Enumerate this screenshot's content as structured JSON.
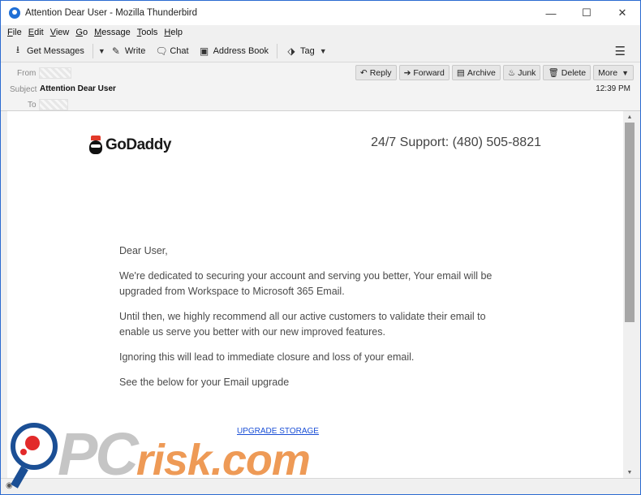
{
  "window": {
    "title": "Attention Dear User - Mozilla Thunderbird",
    "controls": {
      "minimize": "—",
      "maximize": "☐",
      "close": "✕"
    }
  },
  "menubar": [
    "File",
    "Edit",
    "View",
    "Go",
    "Message",
    "Tools",
    "Help"
  ],
  "toolbar": {
    "get_messages": "Get Messages",
    "write": "Write",
    "chat": "Chat",
    "address_book": "Address Book",
    "tag": "Tag"
  },
  "header": {
    "from_label": "From",
    "subject_label": "Subject",
    "subject_value": "Attention Dear User",
    "to_label": "To",
    "time": "12:39 PM",
    "actions": {
      "reply": "Reply",
      "forward": "Forward",
      "archive": "Archive",
      "junk": "Junk",
      "delete": "Delete",
      "more": "More"
    }
  },
  "email": {
    "logo": "GoDaddy",
    "support": "24/7 Support: (480) 505-8821",
    "greeting": "Dear User,",
    "para1": "We're dedicated to securing your account and serving you better, Your email will be upgraded from Workspace to Microsoft 365 Email.",
    "para2": " Until then, we highly recommend all our active customers to validate their email to enable us serve you better with our new improved features.",
    "para3": "Ignoring this will lead to immediate closure and loss of your email.",
    "para4": "See the below for your Email upgrade",
    "link": "UPGRADE STORAGE"
  },
  "watermark": {
    "main": "PC",
    "accent": "risk.com"
  }
}
